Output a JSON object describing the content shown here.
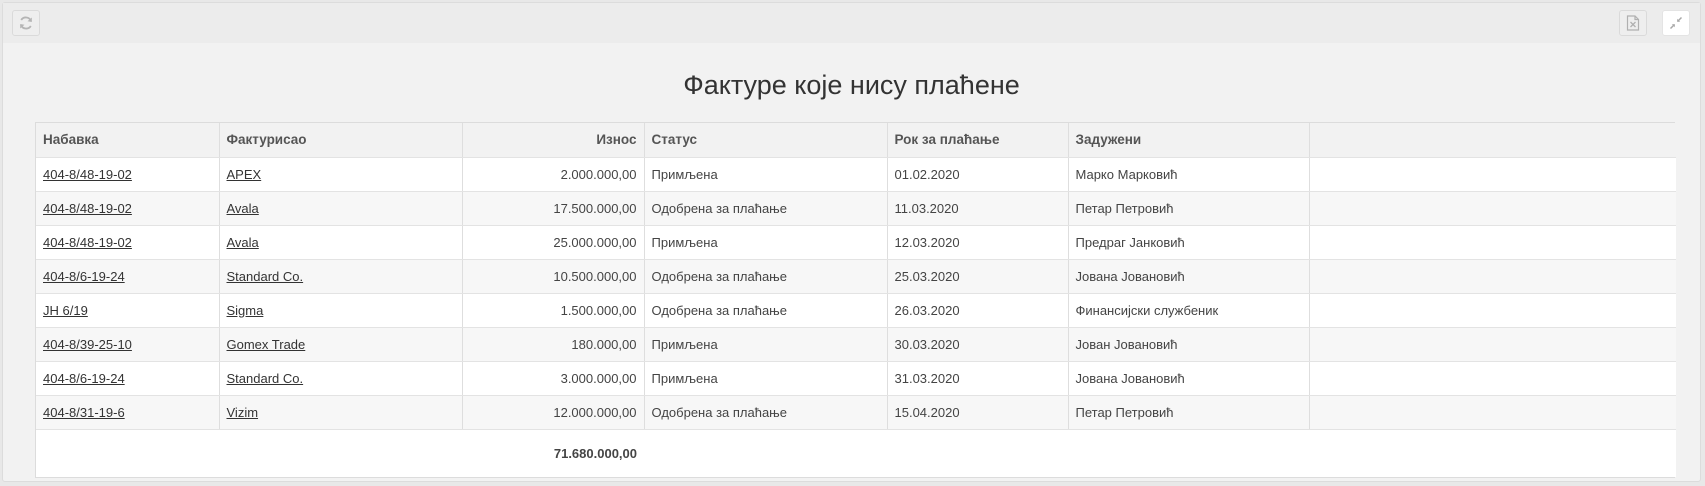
{
  "title": "Фактуре које нису плаћене",
  "toolbar": {
    "refresh_icon": "refresh-icon",
    "excel_icon": "excel-export-icon",
    "collapse_icon": "collapse-icon"
  },
  "table": {
    "columns": [
      "Набавка",
      "Фактурисао",
      "Износ",
      "Статус",
      "Рок за плаћање",
      "Задужени",
      ""
    ],
    "rows": [
      {
        "procurement": "404-8/48-19-02",
        "supplier": "APEX",
        "amount": "2.000.000,00",
        "status": "Примљена",
        "due": "01.02.2020",
        "assignee": "Марко Марковић"
      },
      {
        "procurement": "404-8/48-19-02",
        "supplier": "Avala",
        "amount": "17.500.000,00",
        "status": "Одобрена за плаћање",
        "due": "11.03.2020",
        "assignee": "Петар Петровић"
      },
      {
        "procurement": "404-8/48-19-02",
        "supplier": "Avala",
        "amount": "25.000.000,00",
        "status": "Примљена",
        "due": "12.03.2020",
        "assignee": "Предраг Јанковић"
      },
      {
        "procurement": "404-8/6-19-24",
        "supplier": "Standard Co.",
        "amount": "10.500.000,00",
        "status": "Одобрена за плаћање",
        "due": "25.03.2020",
        "assignee": "Јована Јовановић"
      },
      {
        "procurement": "ЈН 6/19",
        "supplier": "Sigma",
        "amount": "1.500.000,00",
        "status": "Одобрена за плаћање",
        "due": "26.03.2020",
        "assignee": "Финансијски службеник"
      },
      {
        "procurement": "404-8/39-25-10",
        "supplier": "Gomex Trade",
        "amount": "180.000,00",
        "status": "Примљена",
        "due": "30.03.2020",
        "assignee": "Јован Јовановић"
      },
      {
        "procurement": "404-8/6-19-24",
        "supplier": "Standard Co.",
        "amount": "3.000.000,00",
        "status": "Примљена",
        "due": "31.03.2020",
        "assignee": "Јована Јовановић"
      },
      {
        "procurement": "404-8/31-19-6",
        "supplier": "Vizim",
        "amount": "12.000.000,00",
        "status": "Одобрена за плаћање",
        "due": "15.04.2020",
        "assignee": "Петар Петровић"
      }
    ],
    "total": "71.680.000,00"
  }
}
